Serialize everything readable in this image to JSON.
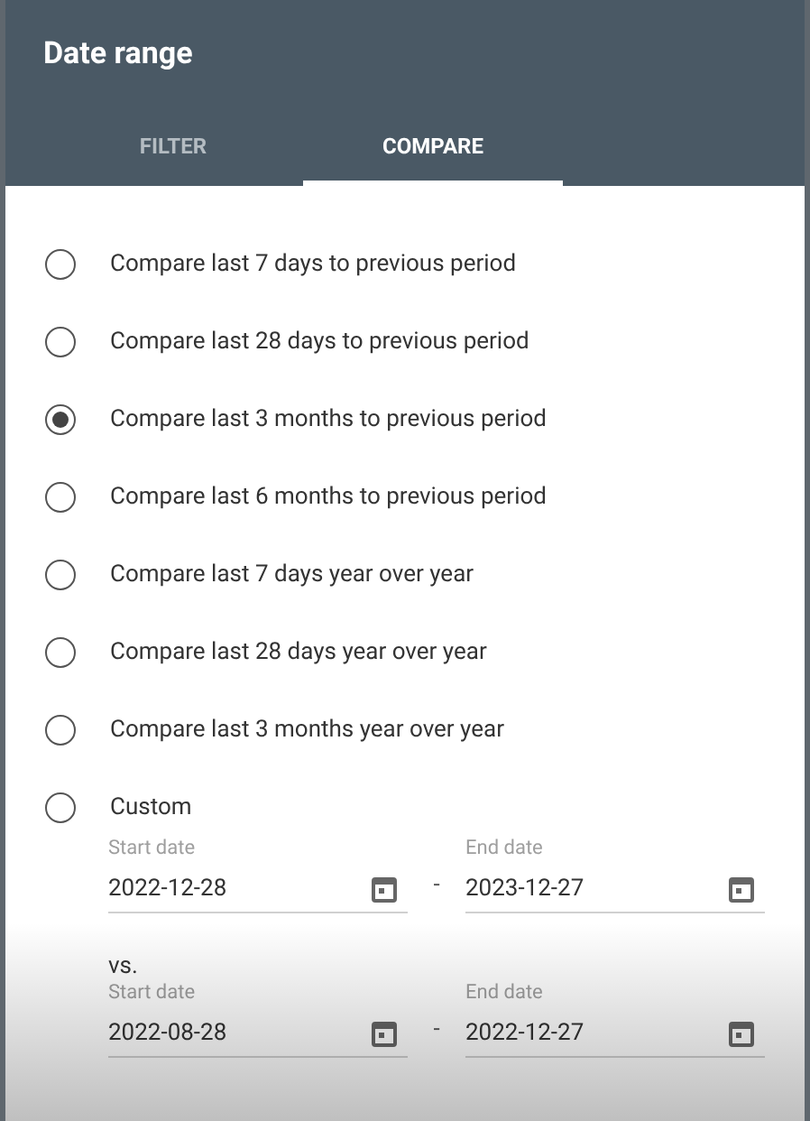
{
  "dialog": {
    "title": "Date range"
  },
  "tabs": [
    {
      "label": "FILTER",
      "selected": false
    },
    {
      "label": "COMPARE",
      "selected": true
    }
  ],
  "options": [
    {
      "label": "Compare last 7 days to previous period",
      "selected": false
    },
    {
      "label": "Compare last 28 days to previous period",
      "selected": false
    },
    {
      "label": "Compare last 3 months to previous period",
      "selected": true
    },
    {
      "label": "Compare last 6 months to previous period",
      "selected": false
    },
    {
      "label": "Compare last 7 days year over year",
      "selected": false
    },
    {
      "label": "Compare last 28 days year over year",
      "selected": false
    },
    {
      "label": "Compare last 3 months year over year",
      "selected": false
    },
    {
      "label": "Custom",
      "selected": false
    }
  ],
  "custom": {
    "ranges": [
      {
        "start_label": "Start date",
        "start": "2022-12-28",
        "separator": "-",
        "end_label": "End date",
        "end": "2023-12-27"
      },
      {
        "start_label": "Start date",
        "start": "2022-08-28",
        "separator": "-",
        "end_label": "End date",
        "end": "2022-12-27"
      }
    ],
    "vs_label": "vs."
  }
}
